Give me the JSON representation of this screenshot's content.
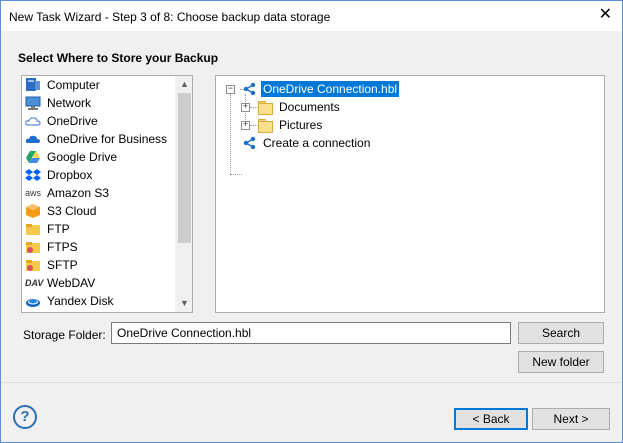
{
  "window": {
    "title": "New Task Wizard - Step 3 of 8: Choose backup data storage",
    "close_glyph": "✕"
  },
  "heading": "Select Where to Store your Backup",
  "storage_list": {
    "selected": "OneDrive",
    "items": [
      {
        "label": "Computer",
        "icon": "computer-icon"
      },
      {
        "label": "Network",
        "icon": "network-icon"
      },
      {
        "label": "OneDrive",
        "icon": "onedrive-icon"
      },
      {
        "label": "OneDrive for Business",
        "icon": "onedrive-business-icon"
      },
      {
        "label": "Google Drive",
        "icon": "google-drive-icon"
      },
      {
        "label": "Dropbox",
        "icon": "dropbox-icon"
      },
      {
        "label": "Amazon S3",
        "icon": "aws-icon"
      },
      {
        "label": "S3 Cloud",
        "icon": "s3-cloud-icon"
      },
      {
        "label": "FTP",
        "icon": "ftp-folder-icon"
      },
      {
        "label": "FTPS",
        "icon": "ftps-folder-icon"
      },
      {
        "label": "SFTP",
        "icon": "sftp-folder-icon"
      },
      {
        "label": "WebDAV",
        "icon": "webdav-icon"
      },
      {
        "label": "Yandex Disk",
        "icon": "yandex-disk-icon"
      }
    ],
    "aws_glyph": "aws",
    "dav_glyph": "DAV"
  },
  "tree": {
    "root": {
      "label": "OneDrive Connection.hbl",
      "expander": "−",
      "icon": "share-icon"
    },
    "children": [
      {
        "label": "Documents",
        "expander": "+",
        "icon": "folder-icon"
      },
      {
        "label": "Pictures",
        "expander": "+",
        "icon": "folder-icon"
      }
    ],
    "create": {
      "label": "Create a connection",
      "icon": "share-icon"
    }
  },
  "storage_folder": {
    "label": "Storage Folder:",
    "value": "OneDrive Connection.hbl"
  },
  "buttons": {
    "search": "Search",
    "new_folder": "New folder",
    "back": "< Back",
    "next": "Next >",
    "help": "?"
  },
  "colors": {
    "selection": "#0078d7",
    "accent_blue": "#2a6fb8"
  }
}
